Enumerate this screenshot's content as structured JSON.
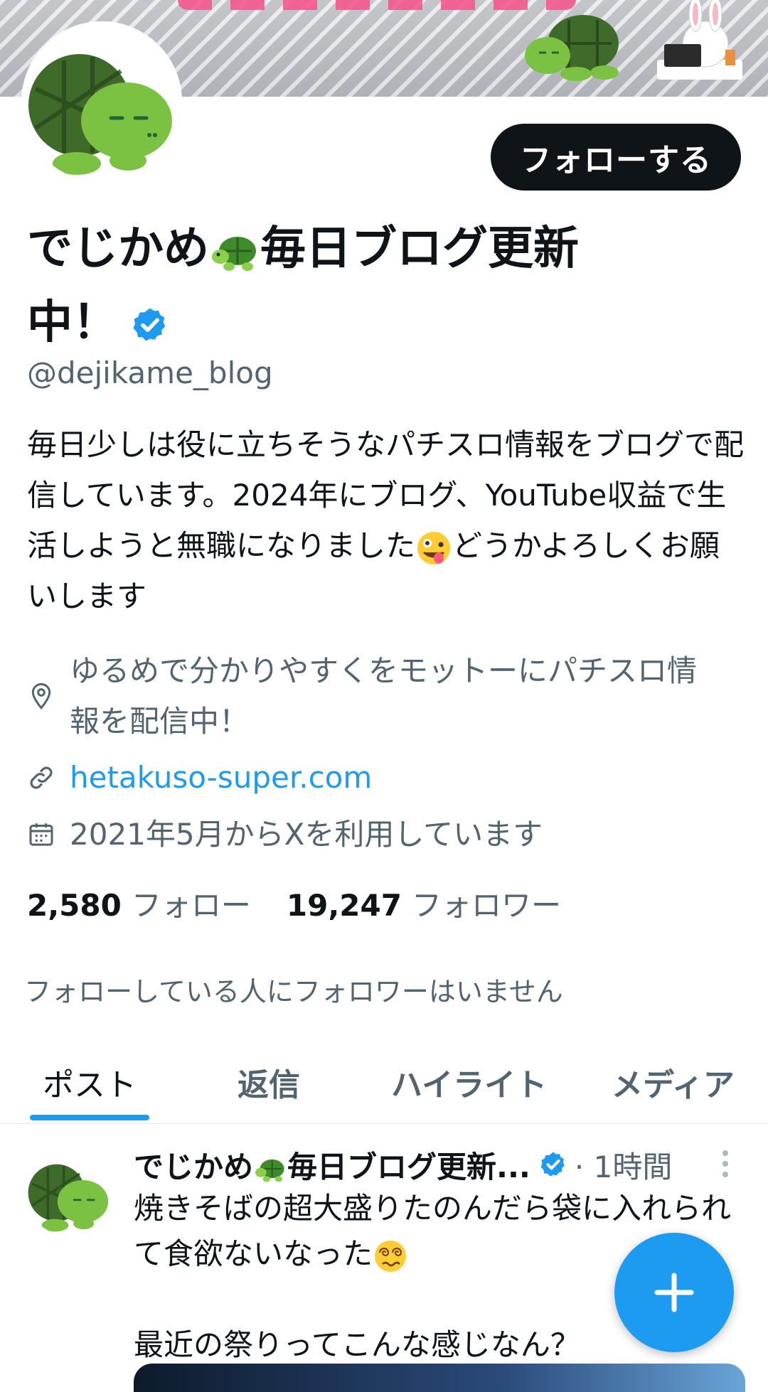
{
  "profile": {
    "name_part1": "でじかめ",
    "name_part2": "毎日ブログ更新中！",
    "handle": "@dejikame_blog",
    "bio_part1": "毎日少しは役に立ちそうなパチスロ情報をブログで配信しています。2024年にブログ、YouTube収益で生活しようと無職になりました",
    "bio_part2": "どうかよろしくお願いします",
    "location": "ゆるめで分かりやすくをモットーにパチスロ情報を配信中！",
    "website": "hetakuso-super.com",
    "joined": "2021年5月からXを利用しています",
    "following_count": "2,580",
    "following_label": "フォロー",
    "followers_count": "19,247",
    "followers_label": "フォロワー",
    "followers_you_know": "フォローしている人にフォロワーはいません"
  },
  "actions": {
    "follow_label": "フォローする"
  },
  "tabs": [
    {
      "label": "ポスト",
      "active": true
    },
    {
      "label": "返信",
      "active": false
    },
    {
      "label": "ハイライト",
      "active": false
    },
    {
      "label": "メディア",
      "active": false
    }
  ],
  "post": {
    "author_part1": "でじかめ",
    "author_part2": "毎日ブログ更新...",
    "time": "· 1時間",
    "text_line1": "焼きそばの超大盛りたのんだら袋に入れられて食欲ないなった",
    "text_line2": "最近の祭りってこんな感じなん？"
  },
  "icons": {
    "verified": "verified-badge-icon",
    "location": "map-pin-icon",
    "link": "link-icon",
    "calendar": "calendar-icon",
    "more": "more-vertical-icon",
    "compose": "plus-icon"
  },
  "colors": {
    "accent": "#1d9bf0",
    "text": "#0f1419",
    "muted": "#536471",
    "button_dark": "#0f1419"
  }
}
